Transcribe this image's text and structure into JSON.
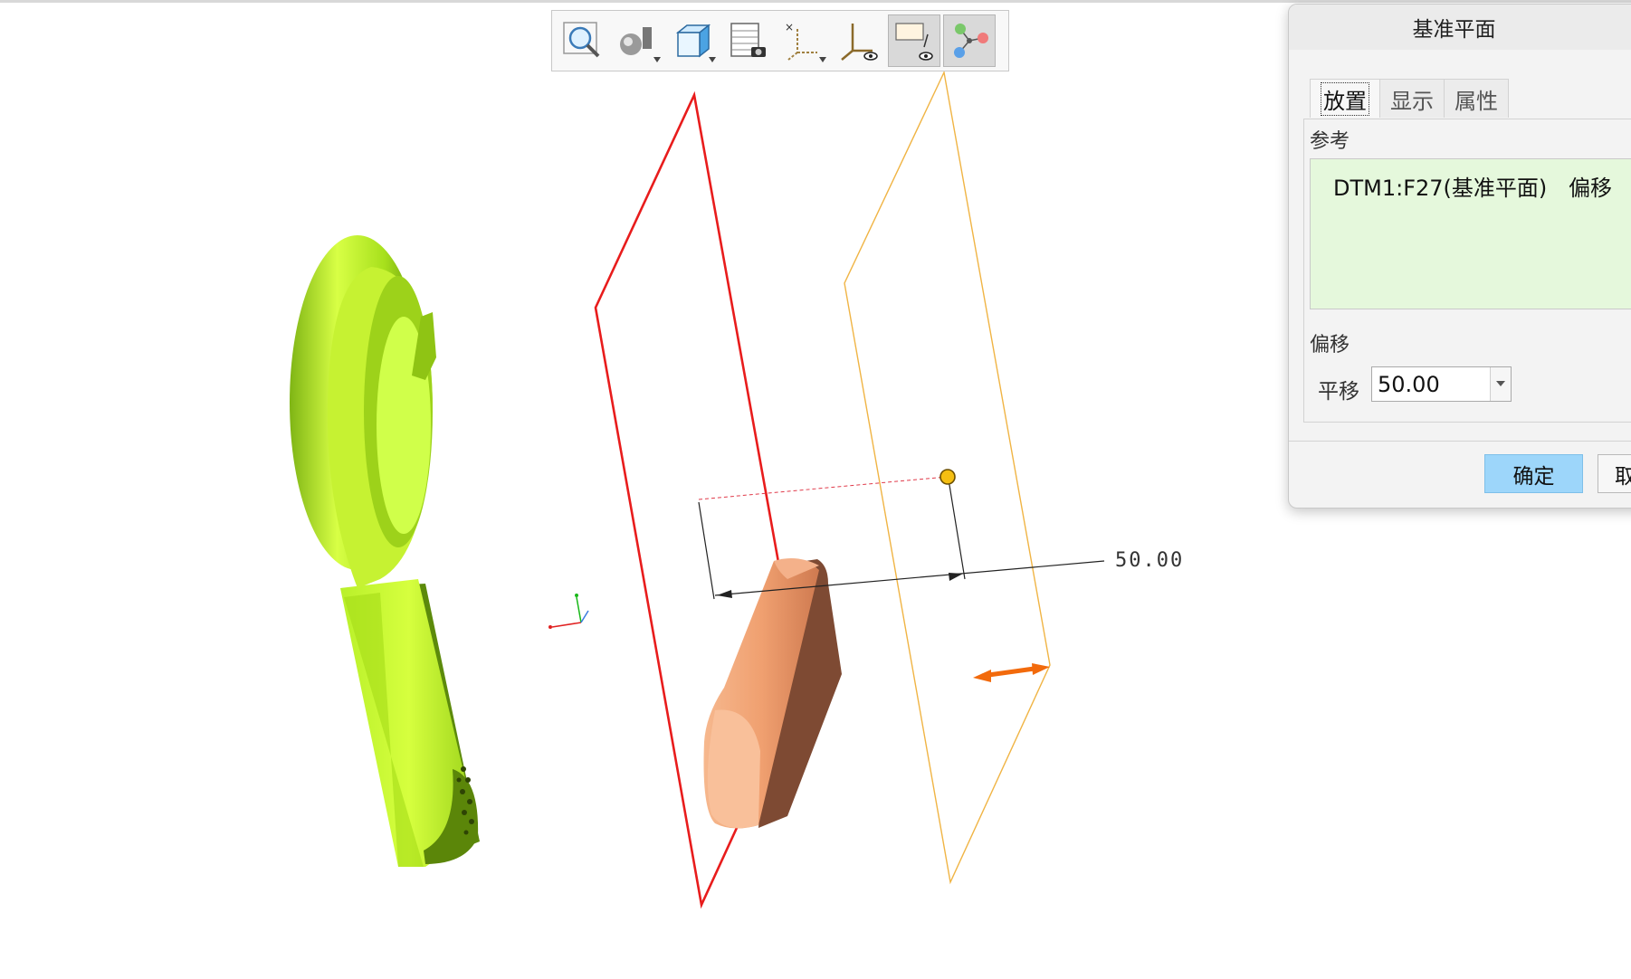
{
  "dialog": {
    "title": "基准平面",
    "tabs": [
      {
        "label": "放置",
        "active": true
      },
      {
        "label": "显示",
        "active": false
      },
      {
        "label": "属性",
        "active": false
      }
    ],
    "references_label": "参考",
    "reference": {
      "name": "DTM1:F27(基准平面)",
      "constraint": "偏移"
    },
    "offset_label": "偏移",
    "translation_label": "平移",
    "translation_value": "50.00",
    "ok_label": "确定",
    "cancel_label": "取消"
  },
  "viewport": {
    "dimension_label": "50.00"
  },
  "toolbar": {
    "icons": [
      "zoom-icon",
      "shading-icon",
      "view-box-icon",
      "saved-views-icon",
      "datum-points-icon",
      "coordinate-system-icon",
      "display-filter-icon",
      "graph-icon"
    ]
  },
  "colors": {
    "reference_plane": "#e81c1c",
    "new_plane": "#f0b444",
    "part_green": "#a8e21d",
    "part_copper": "#e8956a",
    "ok_button": "#9dd6fa",
    "drag_arrow": "#f26a0c"
  }
}
